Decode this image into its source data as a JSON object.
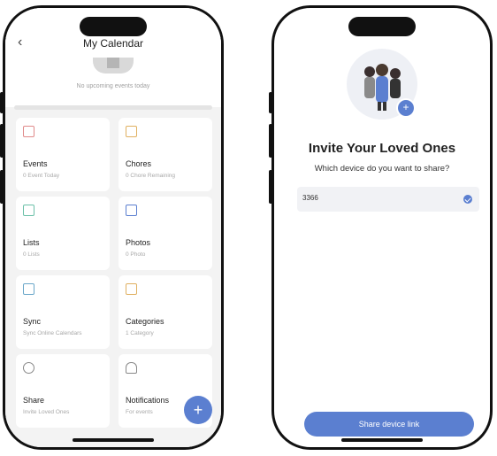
{
  "left_screen": {
    "title": "My Calendar",
    "back_icon": "chevron-left-icon",
    "empty_state": "No upcoming events today",
    "cards": [
      {
        "label": "Events",
        "sub": "0 Event Today",
        "icon": "calendar-icon",
        "color": "#e08a8a"
      },
      {
        "label": "Chores",
        "sub": "0 Chore Remaining",
        "icon": "chores-icon",
        "color": "#e0b060"
      },
      {
        "label": "Lists",
        "sub": "0 Lists",
        "icon": "list-icon",
        "color": "#6bc0a8"
      },
      {
        "label": "Photos",
        "sub": "0 Photo",
        "icon": "photo-icon",
        "color": "#5b7fd0"
      },
      {
        "label": "Sync",
        "sub": "Sync Online Calendars",
        "icon": "sync-icon",
        "color": "#6aa7c9"
      },
      {
        "label": "Categories",
        "sub": "1 Category",
        "icon": "categories-icon",
        "color": "#e0b060"
      },
      {
        "label": "Share",
        "sub": "Invite Loved Ones",
        "icon": "share-user-icon",
        "color": "#888888"
      },
      {
        "label": "Notifications",
        "sub": "For events",
        "icon": "bell-icon",
        "color": "#888888"
      }
    ],
    "fab_label": "+",
    "accent": "#5b7fd0"
  },
  "right_screen": {
    "title": "Invite Your Loved Ones",
    "subtitle": "Which device do you want to share?",
    "device": "3366",
    "plus_label": "+",
    "button_label": "Share device link",
    "accent": "#5b7fd0"
  }
}
